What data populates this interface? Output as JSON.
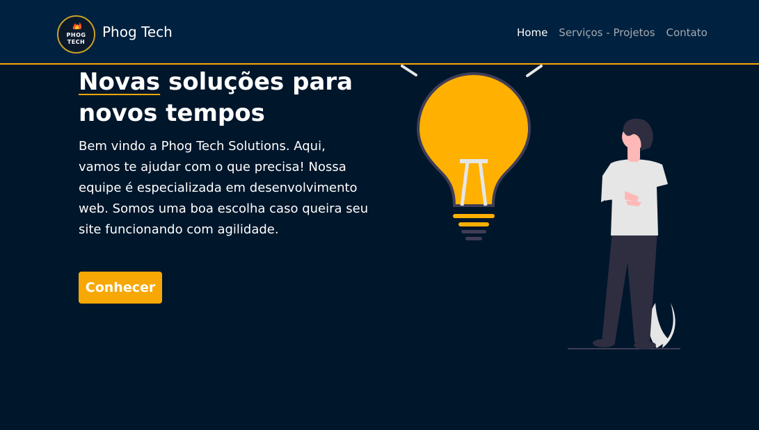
{
  "navbar": {
    "logo_text": "PHOG TECH",
    "brand_name": "Phog Tech",
    "links": [
      {
        "label": "Home",
        "active": true
      },
      {
        "label": "Serviços - Projetos",
        "active": false
      },
      {
        "label": "Contato",
        "active": false
      }
    ]
  },
  "hero": {
    "title_highlight": "Novas",
    "title_rest": " soluções para novos tempos",
    "description": "Bem vindo a Phog Tech Solutions. Aqui, vamos te ajudar com o que precisa! Nossa equipe é especializada em desenvolvimento web. Somos uma boa escolha caso queira seu site funcionando com agilidade.",
    "cta_label": "Conhecer"
  },
  "colors": {
    "background": "#00162b",
    "navbar": "#00213f",
    "accent": "#f7a805"
  },
  "icons": [
    "flame-icon",
    "lightbulb-illustration",
    "person-illustration",
    "plant-illustration"
  ]
}
